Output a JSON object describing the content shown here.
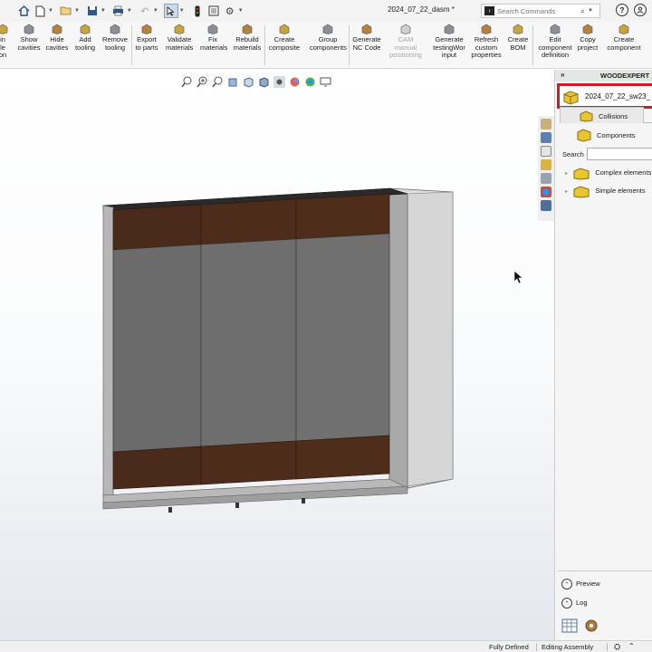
{
  "document": {
    "title": "2024_07_22_dasm *"
  },
  "search_commands": {
    "placeholder": "Search Commands"
  },
  "ribbon": {
    "items": [
      {
        "label": "in\nle\non",
        "icon": "cut-left-icon",
        "disabled": false
      },
      {
        "label": "Show\ncavities",
        "icon": "show-cavities-icon",
        "disabled": false
      },
      {
        "label": "Hide\ncavities",
        "icon": "hide-cavities-icon",
        "disabled": false
      },
      {
        "label": "Add\ntooling",
        "icon": "add-tooling-icon",
        "disabled": false
      },
      {
        "label": "Remove\ntooling",
        "icon": "remove-tooling-icon",
        "disabled": false
      },
      {
        "label": "Export\nto parts",
        "icon": "export-parts-icon",
        "disabled": false
      },
      {
        "label": "Validate\nmaterials",
        "icon": "validate-materials-icon",
        "disabled": false
      },
      {
        "label": "Fix\nmaterials",
        "icon": "fix-materials-icon",
        "disabled": false
      },
      {
        "label": "Rebuild\nmaterials",
        "icon": "rebuild-materials-icon",
        "disabled": false
      },
      {
        "label": "Create\ncomposite",
        "icon": "create-composite-icon",
        "disabled": false
      },
      {
        "label": "Group\ncomponents",
        "icon": "group-components-icon",
        "disabled": false
      },
      {
        "label": "Generate\nNC Code",
        "icon": "nc-code-icon",
        "disabled": false
      },
      {
        "label": "CAM\nmanual\npositioning",
        "icon": "cam-positioning-icon",
        "disabled": true
      },
      {
        "label": "Generate\ntestingWor\ninput",
        "icon": "testing-input-icon",
        "disabled": false
      },
      {
        "label": "Refresh\ncustom\nproperties",
        "icon": "refresh-properties-icon",
        "disabled": false
      },
      {
        "label": "Create\nBOM",
        "icon": "create-bom-icon",
        "disabled": false
      },
      {
        "label": "Edit\ncomponent\ndefinition",
        "icon": "edit-component-icon",
        "disabled": false
      },
      {
        "label": "Copy\nproject",
        "icon": "copy-project-icon",
        "disabled": false
      },
      {
        "label": "Create\ncomponent",
        "icon": "create-component-icon",
        "disabled": false
      }
    ]
  },
  "panel": {
    "header": "WOODEXPERT",
    "assembly": "2024_07_22_sw23_",
    "tab_collisions": "Collisions",
    "tab_components": "Components",
    "search_label": "Search",
    "tree": [
      {
        "label": "Complex elements"
      },
      {
        "label": "Simple elements"
      }
    ],
    "preview": "Preview",
    "log": "Log"
  },
  "status": {
    "defined": "Fully Defined",
    "mode": "Editing Assembly"
  },
  "colors": {
    "accent_red": "#d01b2a",
    "wood_brown": "#4a2a1a",
    "panel_gray": "#6b6b6b"
  }
}
